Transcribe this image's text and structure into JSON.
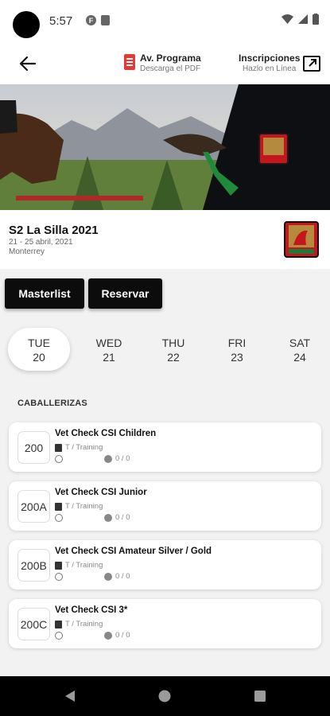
{
  "status": {
    "time": "5:57"
  },
  "header": {
    "programa_title": "Av. Programa",
    "programa_sub": "Descarga el PDF",
    "inscripciones_title": "Inscripciones",
    "inscripciones_sub": "Hazlo en Línea"
  },
  "event": {
    "title": "S2  La Silla 2021",
    "dates": "21 - 25 abril, 2021",
    "city": "Monterrey"
  },
  "buttons": {
    "masterlist": "Masterlist",
    "reservar": "Reservar"
  },
  "days": [
    {
      "dow": "TUE",
      "num": "20"
    },
    {
      "dow": "WED",
      "num": "21"
    },
    {
      "dow": "THU",
      "num": "22"
    },
    {
      "dow": "FRI",
      "num": "23"
    },
    {
      "dow": "SAT",
      "num": "24"
    }
  ],
  "section_title": "CABALLERIZAS",
  "items": [
    {
      "stall": "200",
      "title": "Vet Check CSI Children",
      "type": "T / Training",
      "count": "0 / 0"
    },
    {
      "stall": "200A",
      "title": "Vet Check CSI Junior",
      "type": "T / Training",
      "count": "0 / 0"
    },
    {
      "stall": "200B",
      "title": "Vet Check CSI Amateur Silver / Gold",
      "type": "T / Training",
      "count": "0 / 0"
    },
    {
      "stall": "200C",
      "title": "Vet Check CSI 3*",
      "type": "T / Training",
      "count": "0 / 0"
    }
  ],
  "colors": {
    "accent": "#0c0c0c",
    "pdf": "#e53935"
  }
}
